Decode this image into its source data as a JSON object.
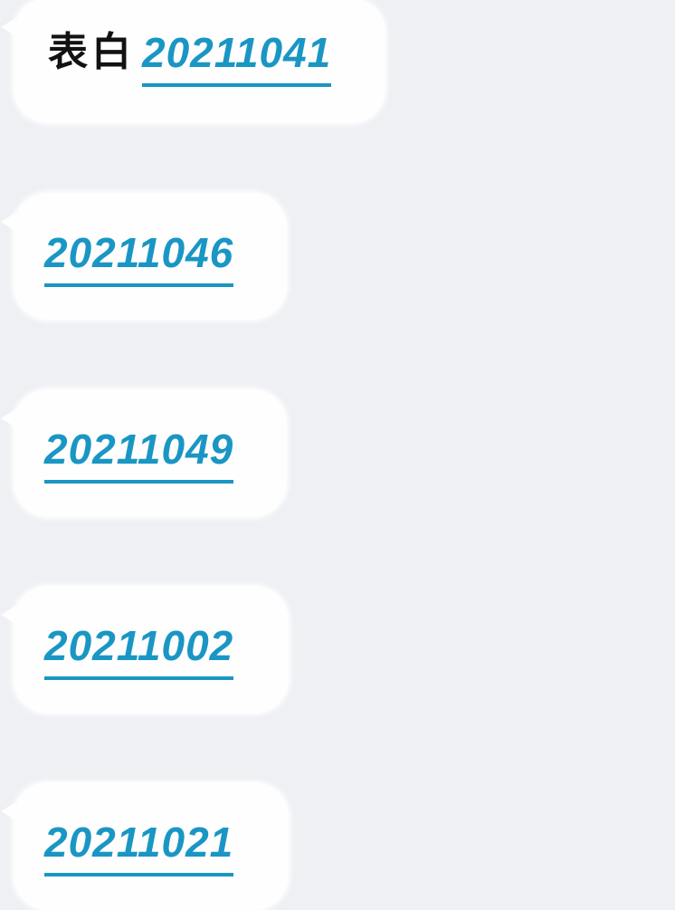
{
  "messages": [
    {
      "prefix": "表白",
      "link": "20211041"
    },
    {
      "link": "20211046"
    },
    {
      "link": "20211049"
    },
    {
      "link": "20211002"
    },
    {
      "link": "20211021"
    }
  ],
  "colors": {
    "background": "#eef0f4",
    "bubble": "#fdfefd",
    "link": "#1a96c4",
    "text": "#121212"
  }
}
